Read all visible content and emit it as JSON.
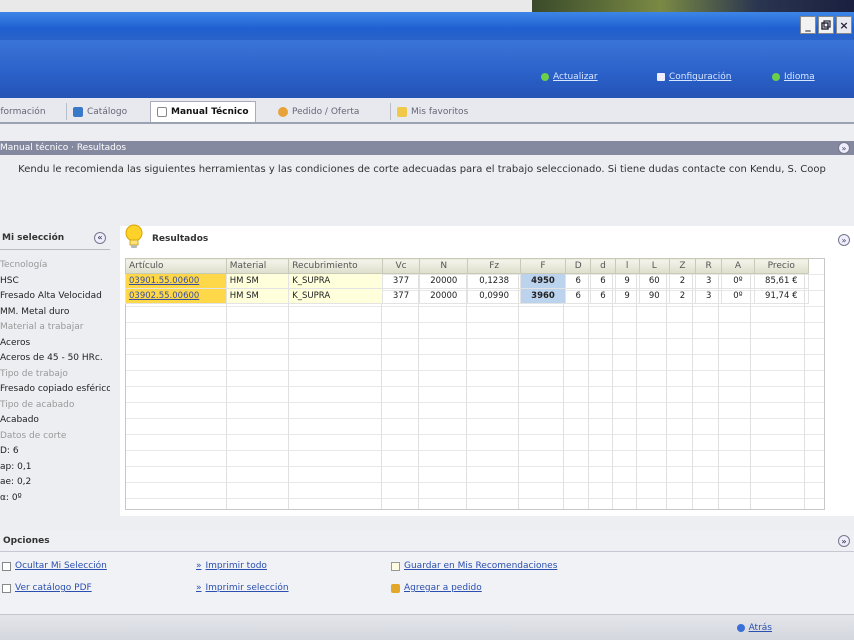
{
  "window": {
    "controls": [
      "_",
      "×"
    ],
    "restore_icon": "restore-icon"
  },
  "top_links": [
    {
      "label": "Actualizar",
      "icon": "green-dot-icon"
    },
    {
      "label": "Configuración",
      "icon": "window-icon"
    },
    {
      "label": "Idioma",
      "icon": "green-dot-icon"
    }
  ],
  "tabs": [
    {
      "label": "Información"
    },
    {
      "label": "Catálogo"
    },
    {
      "label": "Manual Técnico",
      "active": true
    },
    {
      "label": "Pedido / Oferta"
    },
    {
      "label": "Mis favoritos"
    }
  ],
  "breadcrumb": "Manual técnico · Resultados",
  "intro_text": "Kendu le recomienda las siguientes herramientas y las condiciones de corte adecuadas para el trabajo seleccionado. Si tiene dudas contacte con Kendu, S. Coop",
  "my_selection": {
    "title": "Mi selección",
    "rows": [
      {
        "text": "Tecnología",
        "cat": true
      },
      {
        "text": "HSC"
      },
      {
        "text": "Fresado Alta Velocidad"
      },
      {
        "text": "MM. Metal duro"
      },
      {
        "text": "Material a trabajar",
        "cat": true
      },
      {
        "text": "Aceros"
      },
      {
        "text": "Aceros de 45 - 50 HRc."
      },
      {
        "text": "Tipo de trabajo",
        "cat": true
      },
      {
        "text": "Fresado copiado esférico"
      },
      {
        "text": "Tipo de acabado",
        "cat": true
      },
      {
        "text": "Acabado"
      },
      {
        "text": "Datos de corte",
        "cat": true
      },
      {
        "text": "D: 6"
      },
      {
        "text": "ap: 0,1"
      },
      {
        "text": "ae: 0,2"
      },
      {
        "text": "α: 0º"
      }
    ]
  },
  "results": {
    "title": "Resultados",
    "columns": [
      "Artículo",
      "Material",
      "Recubrimiento",
      "Vc",
      "N",
      "Fz",
      "F",
      "D",
      "d",
      "l",
      "L",
      "Z",
      "R",
      "A",
      "Precio"
    ],
    "rows": [
      [
        "03901.55.00600",
        "HM SM",
        "K_SUPRA",
        "377",
        "20000",
        "0,1238",
        "4950",
        "6",
        "6",
        "9",
        "60",
        "2",
        "3",
        "0º",
        "85,61 €"
      ],
      [
        "03902.55.00600",
        "HM SM",
        "K_SUPRA",
        "377",
        "20000",
        "0,0990",
        "3960",
        "6",
        "6",
        "9",
        "90",
        "2",
        "3",
        "0º",
        "91,74 €"
      ]
    ]
  },
  "options": {
    "title": "Opciones",
    "links": [
      {
        "label": "Ocultar Mi Selección"
      },
      {
        "label": "Ver catálogo PDF"
      },
      {
        "label": "Imprimir todo"
      },
      {
        "label": "Imprimir selección"
      },
      {
        "label": "Guardar en Mis Recomendaciones"
      },
      {
        "label": "Agregar a pedido"
      }
    ]
  },
  "footer_link": "Atrás",
  "colors": {
    "header_blue": "#2a60c8",
    "highlight_yellow": "#ffd84a",
    "link_blue": "#2a4fb0"
  }
}
